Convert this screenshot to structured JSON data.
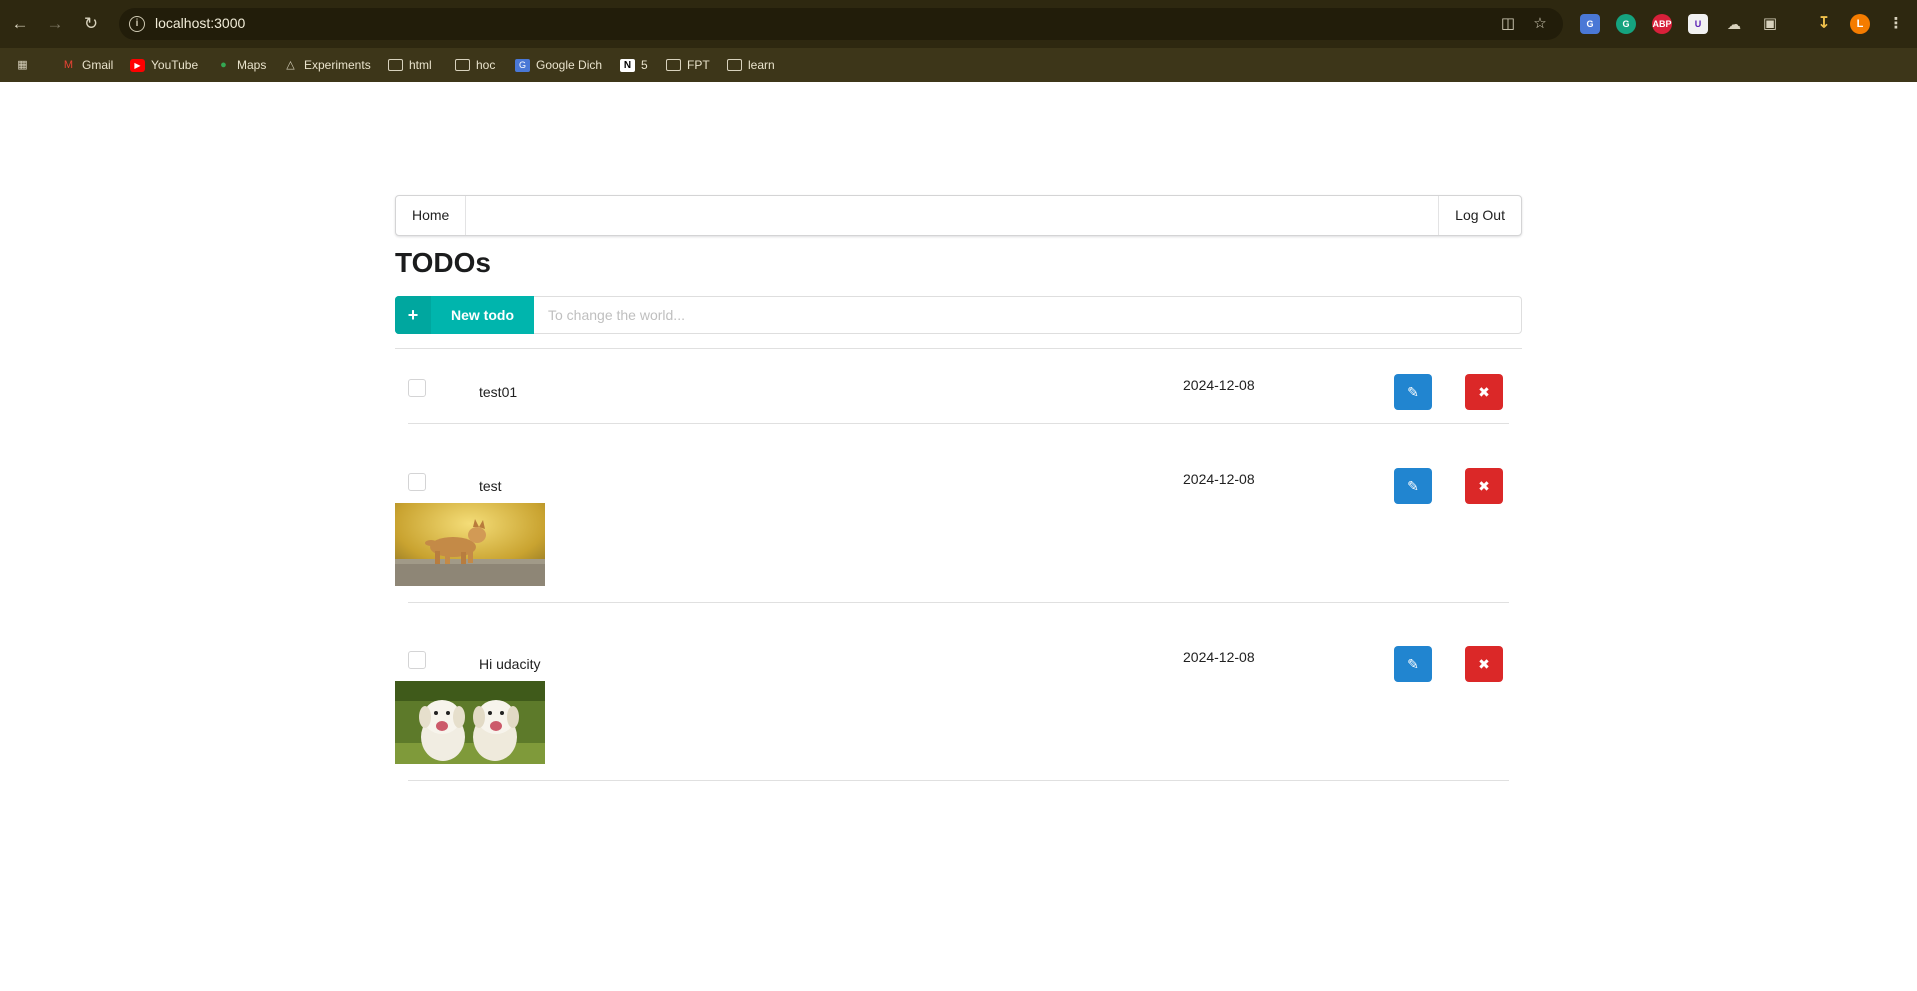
{
  "browser": {
    "url": "localhost:3000",
    "bookmarks": [
      {
        "label": "Gmail",
        "icon": "gmail-icon"
      },
      {
        "label": "YouTube",
        "icon": "youtube-icon"
      },
      {
        "label": "Maps",
        "icon": "maps-icon"
      },
      {
        "label": "Experiments",
        "icon": "flask-icon"
      },
      {
        "label": "html",
        "icon": "folder-icon"
      },
      {
        "label": "hoc",
        "icon": "folder-icon"
      },
      {
        "label": "Google Dich",
        "icon": "translate-icon"
      },
      {
        "label": "5",
        "icon": "notion-icon"
      },
      {
        "label": "FPT",
        "icon": "folder-icon"
      },
      {
        "label": "learn",
        "icon": "folder-icon"
      }
    ],
    "profile_initial": "L",
    "colors": {
      "chrome": "#3d3619",
      "toolbar": "#2e2810",
      "profile": "#f57c00"
    }
  },
  "menu": {
    "home_label": "Home",
    "logout_label": "Log Out"
  },
  "page": {
    "title": "TODOs"
  },
  "new_todo": {
    "button_label": "New todo",
    "placeholder": "To change the world...",
    "color": "#00b5ad"
  },
  "todos": [
    {
      "name": "test01",
      "due_date": "2024-12-08",
      "done": false,
      "image": null
    },
    {
      "name": "test",
      "due_date": "2024-12-08",
      "done": false,
      "image": "puppy-running-photo"
    },
    {
      "name": "Hi udacity",
      "due_date": "2024-12-08",
      "done": false,
      "image": "two-white-puppies-photo"
    }
  ],
  "colors": {
    "edit": "#2185d0",
    "delete": "#db2828"
  }
}
